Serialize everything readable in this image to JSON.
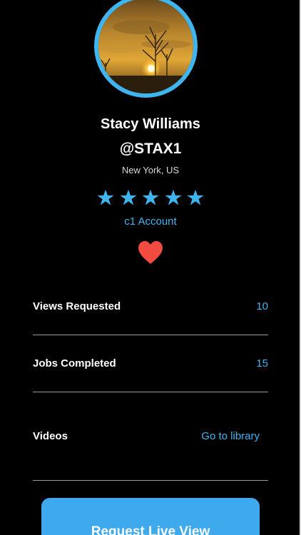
{
  "profile": {
    "name": "Stacy Williams",
    "handle": "@STAX1",
    "location": "New York, US",
    "rating": 5,
    "rating_max": 5,
    "account_type": "c1 Account",
    "accent_color": "#3fb4ee",
    "heart_color": "#f24b3f",
    "avatar_icon": "sunset-photo"
  },
  "stats": {
    "views_requested": {
      "label": "Views Requested",
      "value": "10"
    },
    "jobs_completed": {
      "label": "Jobs Completed",
      "value": "15"
    },
    "videos": {
      "label": "Videos",
      "link": "Go to library"
    }
  },
  "actions": {
    "request_live_view": "Request Live View"
  }
}
